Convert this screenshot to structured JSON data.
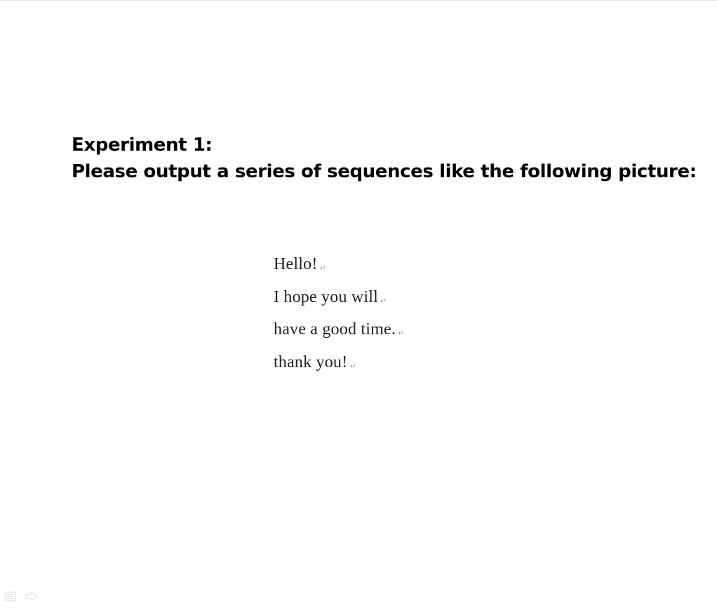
{
  "slide": {
    "heading_line1": "Experiment 1:",
    "heading_line2": "Please output a series of sequences like the following picture:"
  },
  "sample_output": {
    "lines": [
      "Hello!",
      "I hope you will",
      "have a good time.",
      "thank you!"
    ],
    "paragraph_marks": [
      "↵",
      "↵",
      "↵",
      "↵"
    ]
  },
  "navigation": {
    "icons": [
      "slide-menu-icon",
      "next-slide-arrow-icon"
    ],
    "color": "#b8b8b8"
  },
  "colors": {
    "background": "#ffffff",
    "heading_text": "#000000",
    "sample_text": "#222222"
  }
}
